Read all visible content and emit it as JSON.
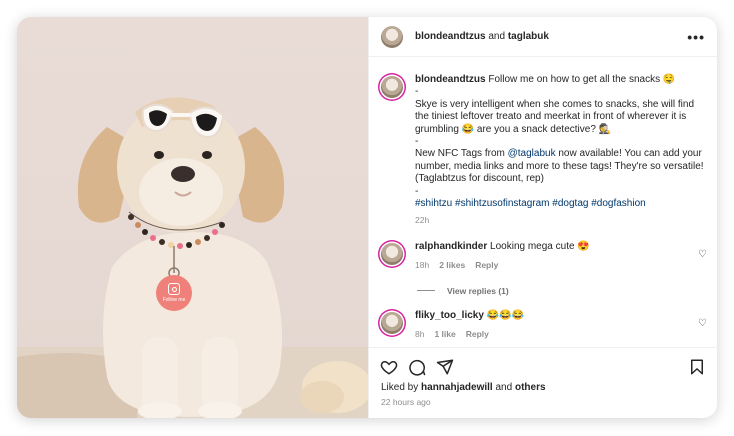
{
  "header": {
    "user": "blondeandtzus",
    "and_text": "and",
    "collaborator": "taglabuk",
    "more": "•••"
  },
  "caption": {
    "user": "blondeandtzus",
    "line1": "Follow me on how to get all the snacks 🤤",
    "sep1": "-",
    "para1": "Skye is very intelligent when she comes to snacks, she will find the tiniest leftover treato and meerkat in front of wherever it is grumbling 😂 are you a snack detective? 🕵️",
    "sep2": "-",
    "para2_pre": "New NFC Tags from ",
    "para2_mention": "@taglabuk",
    "para2_post": " now available! You can add your number, media links and more to these tags! They're so versatile! (Taglabtzus for discount, rep)",
    "sep3": "-",
    "hashtags": "#shihtzu #shihtzusofinstagram #dogtag #dogfashion",
    "time": "22h"
  },
  "comments": [
    {
      "user": "ralphandkinder",
      "text": "Looking mega cute 😍",
      "time": "18h",
      "likes": "2 likes",
      "reply": "Reply"
    },
    {
      "user": "fliky_too_licky",
      "text": "😂😂😂",
      "time": "8h",
      "likes": "1 like",
      "reply": "Reply"
    }
  ],
  "view_replies": "View replies (1)",
  "liked_by": {
    "prefix": "Liked by",
    "user": "hannahjadewill",
    "and": "and",
    "others": "others"
  },
  "posted": "22 hours ago",
  "tag_text": "Follow me",
  "colors": {
    "link": "#00376b",
    "muted": "#8e8e8e",
    "story_ring": "#d6249f"
  }
}
